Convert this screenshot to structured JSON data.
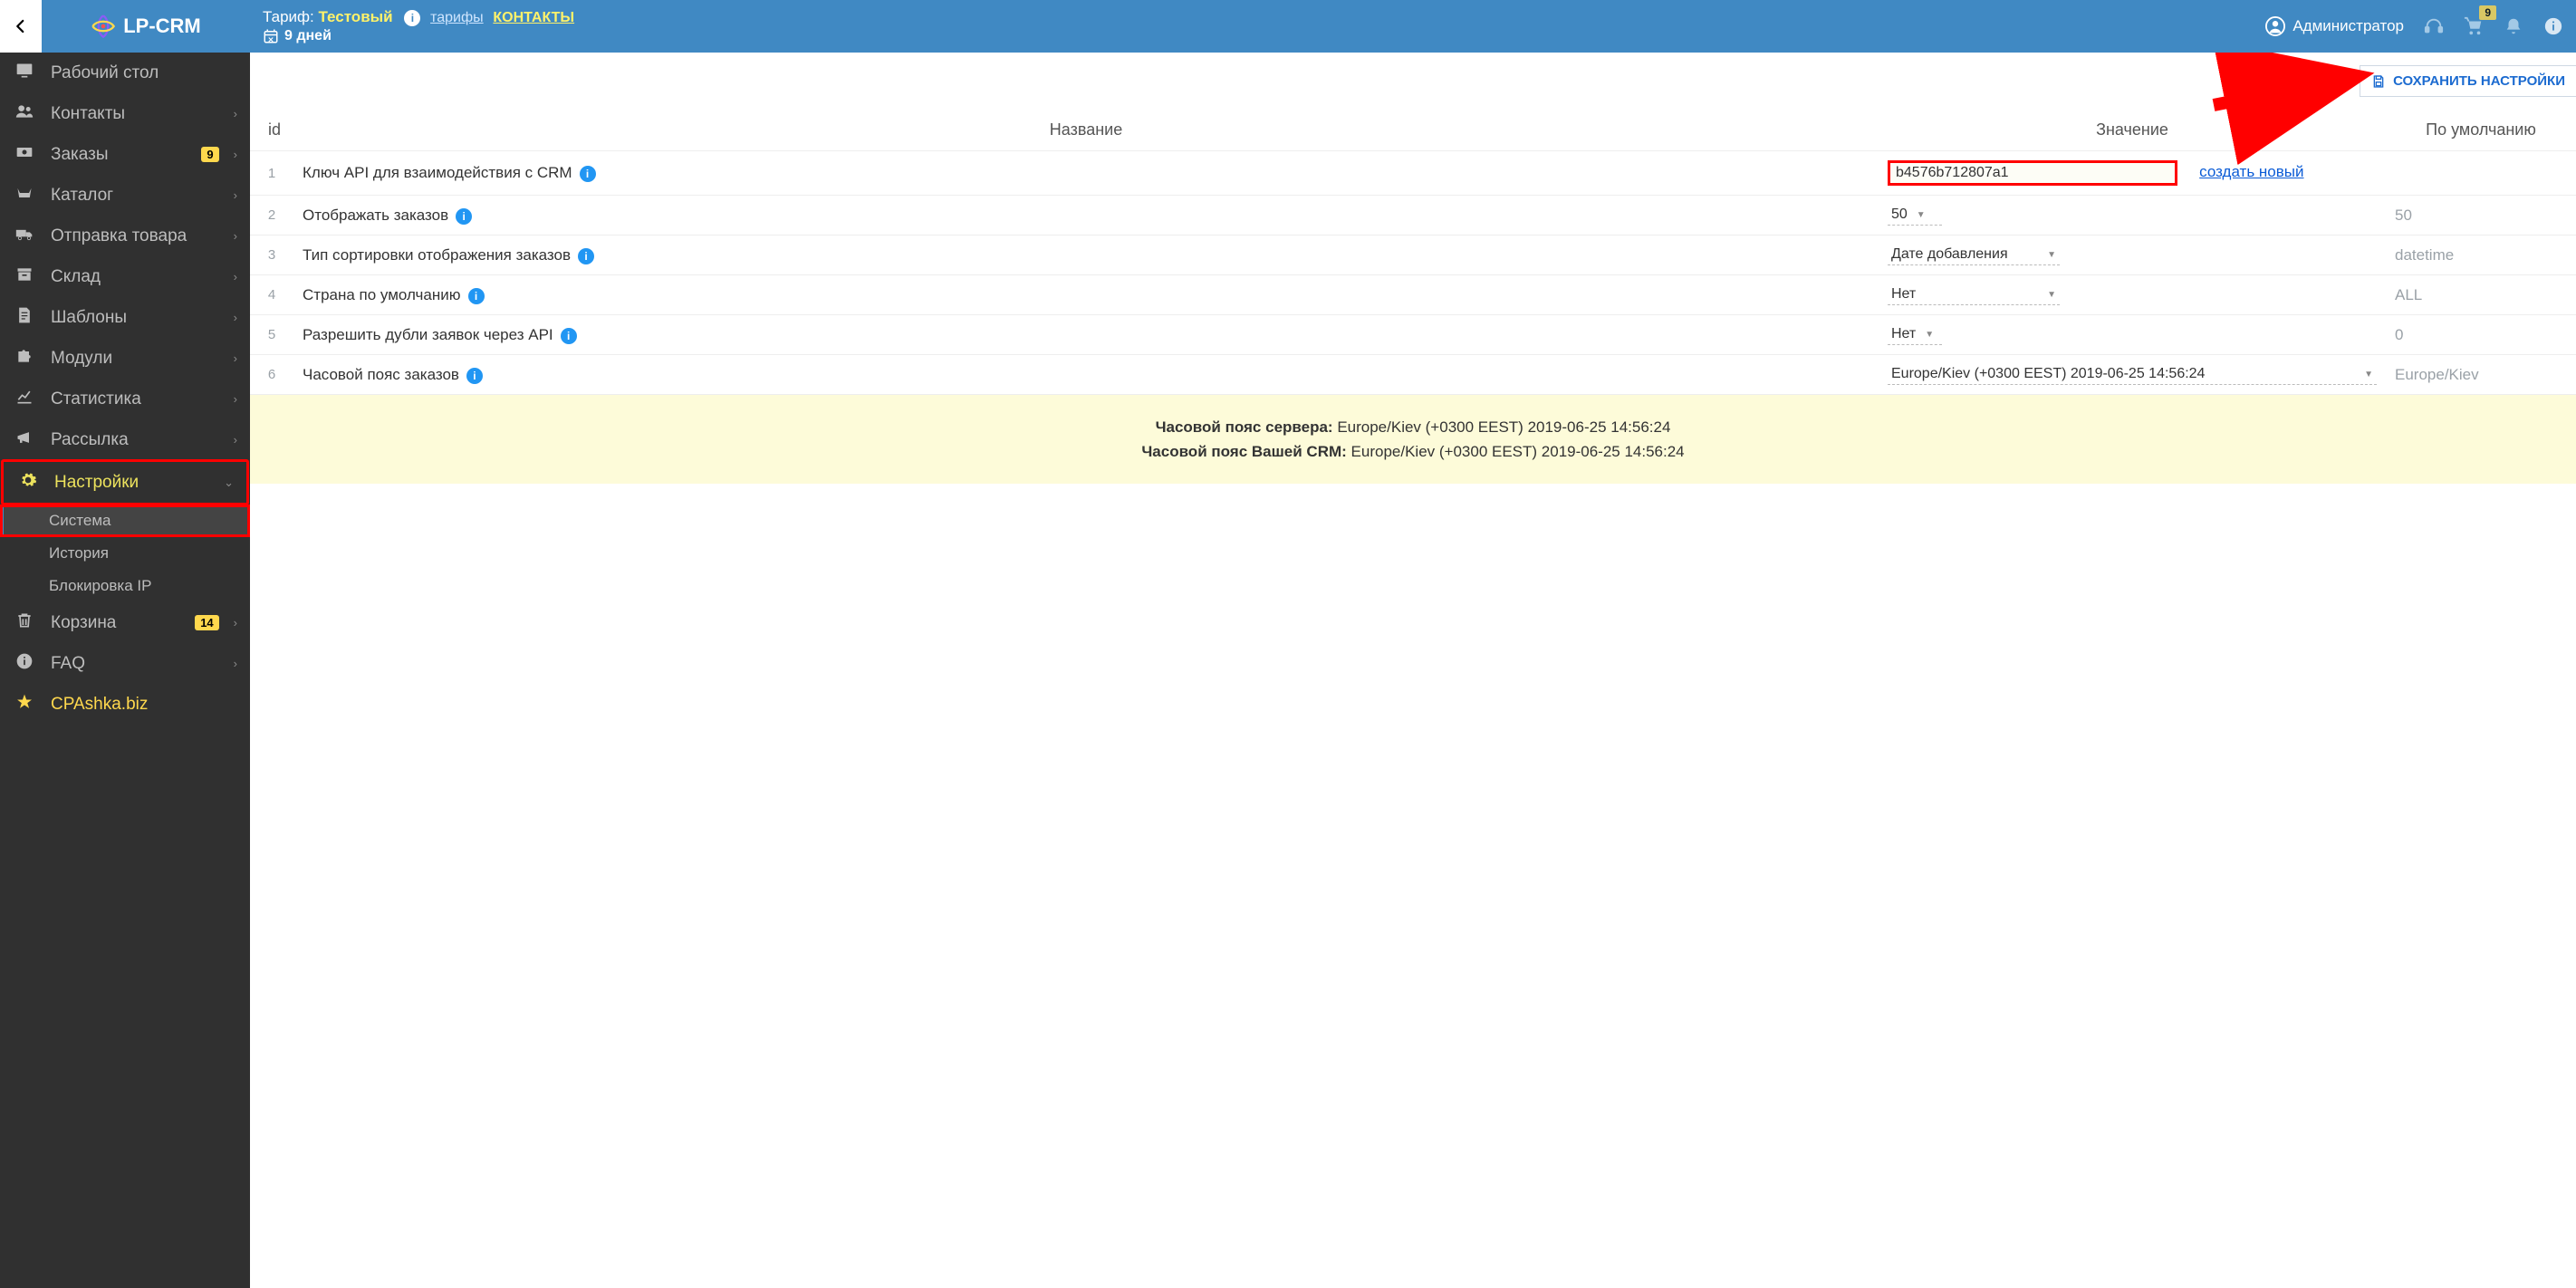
{
  "brand": {
    "name": "LP-CRM"
  },
  "topbar": {
    "tariff_label": "Тариф:",
    "tariff_value": "Тестовый",
    "tariffs_link": "тарифы",
    "contacts_link": "КОНТАКТЫ",
    "days": "9 дней",
    "user": "Администратор",
    "cart_badge": "9"
  },
  "save_button": "СОХРАНИТЬ НАСТРОЙКИ",
  "sidebar": {
    "items": [
      {
        "label": "Рабочий стол"
      },
      {
        "label": "Контакты"
      },
      {
        "label": "Заказы",
        "badge": "9"
      },
      {
        "label": "Каталог"
      },
      {
        "label": "Отправка товара"
      },
      {
        "label": "Склад"
      },
      {
        "label": "Шаблоны"
      },
      {
        "label": "Модули"
      },
      {
        "label": "Статистика"
      },
      {
        "label": "Рассылка"
      },
      {
        "label": "Настройки"
      },
      {
        "label": "Корзина",
        "badge": "14"
      },
      {
        "label": "FAQ"
      },
      {
        "label": "CPAshka.biz"
      }
    ],
    "sub": [
      {
        "label": "Система"
      },
      {
        "label": "История"
      },
      {
        "label": "Блокировка IP"
      }
    ]
  },
  "table": {
    "headers": {
      "id": "id",
      "name": "Название",
      "value": "Значение",
      "def": "По умолчанию"
    },
    "rows": [
      {
        "idx": "1",
        "name": "Ключ API для взаимодействия с CRM",
        "value_token": "b4576b712807a1",
        "value_link": "создать новый",
        "def": ""
      },
      {
        "idx": "2",
        "name": "Отображать заказов",
        "value_select": "50",
        "def": "50"
      },
      {
        "idx": "3",
        "name": "Тип сортировки отображения заказов",
        "value_select": "Дате добавления",
        "def": "datetime"
      },
      {
        "idx": "4",
        "name": "Страна по умолчанию",
        "value_select": "Нет",
        "def": "ALL"
      },
      {
        "idx": "5",
        "name": "Разрешить дубли заявок через API",
        "value_select": "Нет",
        "def": "0"
      },
      {
        "idx": "6",
        "name": "Часовой пояс заказов",
        "value_select": "Europe/Kiev (+0300 EEST) 2019-06-25 14:56:24",
        "def": "Europe/Kiev"
      }
    ]
  },
  "notice": {
    "l1_label": "Часовой пояс сервера: ",
    "l1_value": "Europe/Kiev (+0300 EEST) 2019-06-25 14:56:24",
    "l2_label": "Часовой пояс Вашей CRM: ",
    "l2_value": "Europe/Kiev (+0300 EEST) 2019-06-25 14:56:24"
  }
}
